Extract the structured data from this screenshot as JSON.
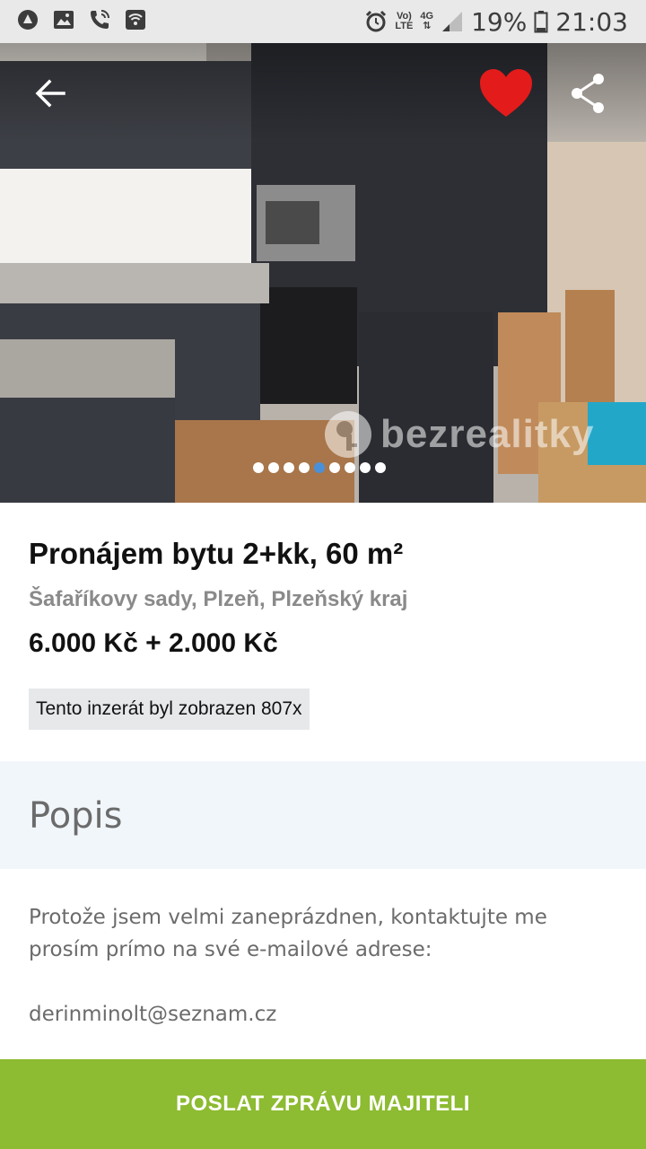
{
  "status_bar": {
    "network_top": "Vo)",
    "network_bottom": "LTE",
    "signal_type": "4G",
    "battery": "19%",
    "time": "21:03"
  },
  "gallery": {
    "watermark": "bezrealitky",
    "image_count": 9,
    "active_index": 4
  },
  "listing": {
    "title": "Pronájem bytu 2+kk, 60 m²",
    "address": "Šafaříkovy sady, Plzeň, Plzeňský kraj",
    "price": "6.000 Kč + 2.000 Kč",
    "views": "Tento inzerát byl zobrazen 807x"
  },
  "description": {
    "heading": "Popis",
    "text": "Protože jsem velmi zaneprázdnen, kontaktujte me prosím prímo na své e-mailové adrese:",
    "email": "derinminolt@seznam.cz"
  },
  "cta": {
    "label": "POSLAT ZPRÁVU MAJITELI"
  },
  "colors": {
    "accent": "#8dbb31",
    "favorite": "#e41b1b",
    "active_dot": "#4a90d9"
  }
}
